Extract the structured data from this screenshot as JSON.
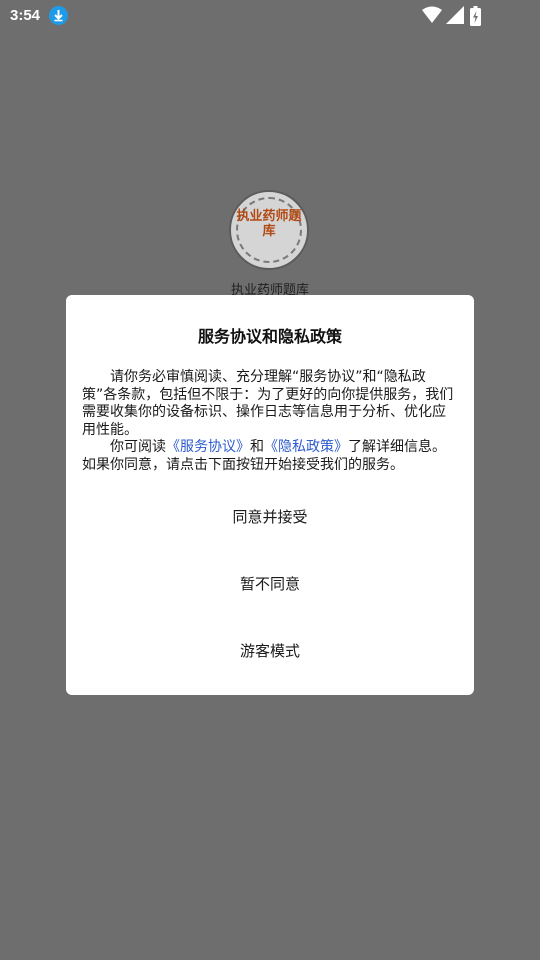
{
  "status_bar": {
    "time": "3:54",
    "icons": [
      "download-icon",
      "wifi-icon",
      "signal-icon",
      "battery-charging-icon"
    ]
  },
  "app": {
    "logo_text": "执业药师题库",
    "name": "执业药师题库"
  },
  "dialog": {
    "title": "服务协议和隐私政策",
    "para1": "请你务必审慎阅读、充分理解“服务协议”和“隐私政策”各条款，包括但不限于：为了更好的向你提供服务，我们需要收集你的设备标识、操作日志等信息用于分析、优化应用性能。",
    "para2_prefix": "你可阅读",
    "link_service": "《服务协议》",
    "para2_and": "和",
    "link_privacy": "《隐私政策》",
    "para2_suffix": "了解详细信息。如果你同意，请点击下面按钮开始接受我们的服务。",
    "agree_label": "同意并接受",
    "disagree_label": "暂不同意",
    "guest_label": "游客模式"
  },
  "colors": {
    "overlay": "#6e6e6e",
    "link": "#2d5bcf",
    "download_badge": "#1e9be8"
  }
}
